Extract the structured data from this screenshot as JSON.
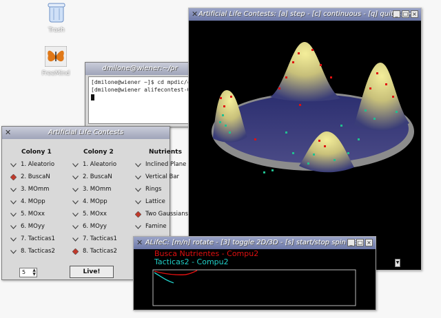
{
  "desktop": {
    "icons": [
      {
        "name": "trash",
        "label": "Trash"
      },
      {
        "name": "freemind",
        "label": "FreeMind"
      }
    ]
  },
  "terminal": {
    "title": "dmilone@wiener:~/pr",
    "lines": [
      "[dmilone@wiener ~]$ cd mpdic/c",
      "[dmilone@wiener alifecontest-0"
    ]
  },
  "control": {
    "title": "Artificial Life Contests",
    "colony1": {
      "header": "Colony 1",
      "options": [
        "1. Aleatorio",
        "2. BuscaN",
        "3. MOmm",
        "4. MOpp",
        "5. MOxx",
        "6. MOyy",
        "7. Tacticas1",
        "8. Tacticas2"
      ],
      "selected": 1
    },
    "colony2": {
      "header": "Colony 2",
      "options": [
        "1. Aleatorio",
        "2. BuscaN",
        "3. MOmm",
        "4. MOpp",
        "5. MOxx",
        "6. MOyy",
        "7. Tacticas1",
        "8. Tacticas2"
      ],
      "selected": 7
    },
    "nutrients": {
      "header": "Nutrients",
      "options": [
        "Inclined Plane",
        "Vertical Bar",
        "Rings",
        "Lattice",
        "Two Gaussians",
        "Famine"
      ],
      "selected": 4
    },
    "spin_value": "5",
    "live_label": "Live!"
  },
  "view3d": {
    "title": "Artificial Life Contests: [a] step - [c] continuous - [q] quit <3>"
  },
  "plot": {
    "title": "ALifeC: [m/n] rotate - [3] toggle 2D/3D - [s] start/stop spin <3>",
    "series": [
      {
        "name": "Busca Nutrientes - Compu2",
        "color": "#e01010"
      },
      {
        "name": "Tacticas2 - Compu2",
        "color": "#20d0c8"
      }
    ]
  },
  "colors": {
    "surface_high": "#f0e890",
    "surface_low": "#2a2e6e",
    "ring": "#9a9a9a",
    "marker_red": "#e01010",
    "marker_teal": "#20c090"
  }
}
